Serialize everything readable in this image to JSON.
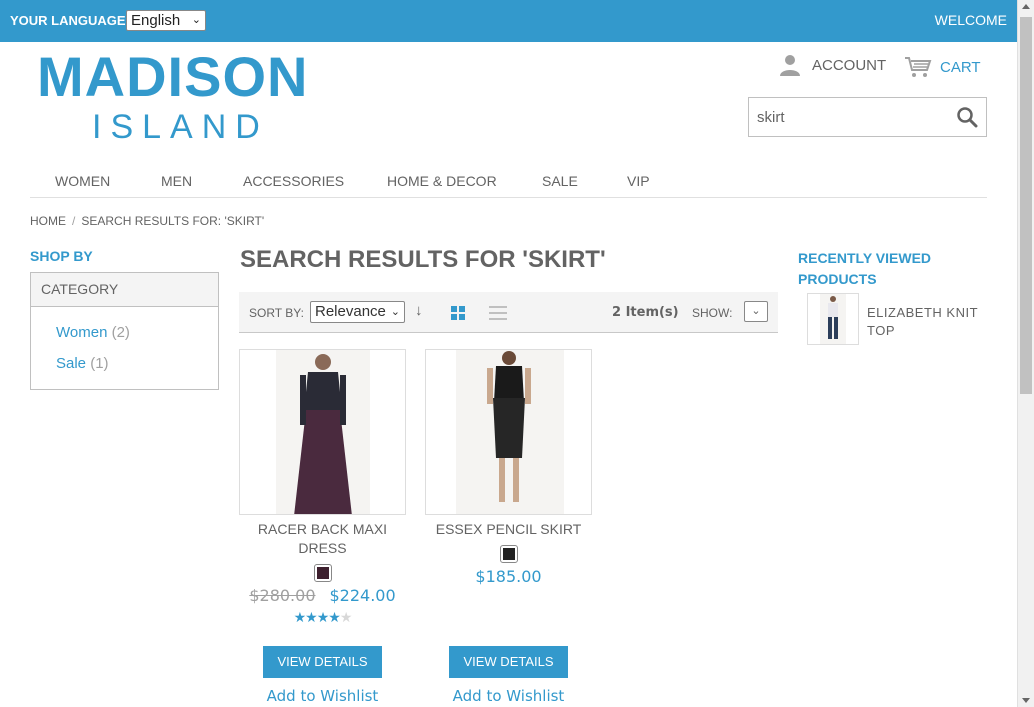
{
  "topbar": {
    "language_label": "YOUR LANGUAGE:",
    "language_value": "English",
    "welcome": "WELCOME"
  },
  "logo": {
    "main": "MADISON",
    "sub": "ISLAND"
  },
  "header": {
    "account": "ACCOUNT",
    "cart": "CART",
    "search_value": "skirt"
  },
  "nav": [
    "WOMEN",
    "MEN",
    "ACCESSORIES",
    "HOME & DECOR",
    "SALE",
    "VIP"
  ],
  "breadcrumb": {
    "home": "HOME",
    "separator": "/",
    "current": "SEARCH RESULTS FOR: 'SKIRT'"
  },
  "sidebar": {
    "title": "SHOP BY",
    "category_header": "CATEGORY",
    "items": [
      {
        "label": "Women",
        "count": "(2)"
      },
      {
        "label": "Sale",
        "count": "(1)"
      }
    ]
  },
  "main": {
    "title": "SEARCH RESULTS FOR 'SKIRT'",
    "toolbar": {
      "sort_label": "SORT BY:",
      "sort_value": "Relevance",
      "item_count": "2 Item(s)",
      "show_label": "SHOW:"
    }
  },
  "products": [
    {
      "name": "RACER BACK MAXI DRESS",
      "swatch_color": "#3d1f2e",
      "old_price": "$280.00",
      "price": "$224.00",
      "rating_stars": 4,
      "button": "VIEW DETAILS",
      "wishlist": "Add to Wishlist"
    },
    {
      "name": "ESSEX PENCIL SKIRT",
      "swatch_color": "#222222",
      "price": "$185.00",
      "button": "VIEW DETAILS",
      "wishlist": "Add to Wishlist"
    }
  ],
  "recently_viewed": {
    "title_line1": "RECENTLY VIEWED",
    "title_line2": "PRODUCTS",
    "item_name_line1": "ELIZABETH KNIT",
    "item_name_line2": "TOP"
  },
  "colors": {
    "accent": "#3399cc",
    "text": "#636363"
  }
}
